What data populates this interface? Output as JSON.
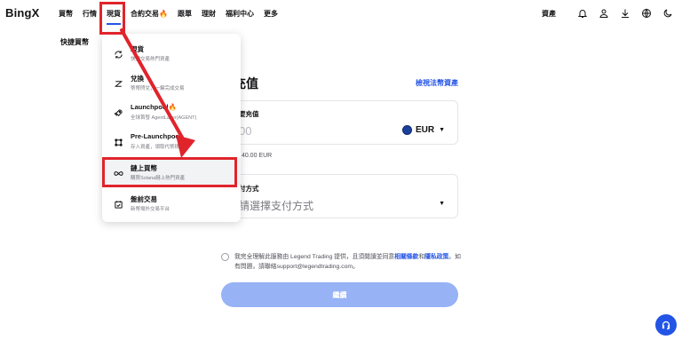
{
  "brand": {
    "logo": "BingX"
  },
  "nav": {
    "items": [
      {
        "label": "買幣",
        "fire": false
      },
      {
        "label": "行情",
        "fire": false
      },
      {
        "label": "現貨",
        "fire": false,
        "active": true
      },
      {
        "label": "合約交易",
        "fire": true
      },
      {
        "label": "跟單",
        "fire": false
      },
      {
        "label": "理財",
        "fire": false
      },
      {
        "label": "福利中心",
        "fire": false
      },
      {
        "label": "更多",
        "fire": false
      }
    ],
    "right": {
      "asset_label": "資產"
    }
  },
  "subheader": {
    "title": "快捷買幣"
  },
  "dropdown": {
    "items": [
      {
        "title": "現貨",
        "desc": "快捷交易熱門資產",
        "icon": "spot-icon",
        "fire": false
      },
      {
        "title": "兌換",
        "desc": "幣幣閃兌，一鍵完成交易",
        "icon": "convert-icon",
        "fire": false
      },
      {
        "title": "Launchpool",
        "desc": "全球首發 AgentLayer(AGENT)",
        "icon": "rocket-icon",
        "fire": true
      },
      {
        "title": "Pre-Launchpool",
        "desc": "存入資產，領取代幣積分",
        "icon": "prelaunch-icon",
        "fire": false
      },
      {
        "title": "鏈上買幣",
        "desc": "購買Solana鏈上熱門資產",
        "icon": "infinity-icon",
        "fire": false,
        "highlighted": true
      },
      {
        "title": "盤前交易",
        "desc": "新幣場外交易平台",
        "icon": "calendar-icon",
        "fire": false
      }
    ]
  },
  "main": {
    "heading": "充值",
    "view_link": "檢視法幣資產",
    "amount": {
      "label": "要充值",
      "placeholder": "00",
      "currency": "EUR"
    },
    "limit_text": "額 40.00 EUR",
    "payment": {
      "label": "付方式",
      "placeholder": "請選擇支付方式"
    },
    "agreement": {
      "prefix": "我完全理解此服務由 Legend Trading 提供，且須閱讀並同意",
      "link1": "相關條款",
      "mid": "和",
      "link2": "隱私政策",
      "suffix": "。如有問題，請聯絡support@legendtrading.com。"
    },
    "cta": "繼續"
  },
  "colors": {
    "accent": "#2354e6",
    "cta_disabled": "#97b2f5",
    "annotation": "#e0242b",
    "fire": "#f26a1b"
  }
}
